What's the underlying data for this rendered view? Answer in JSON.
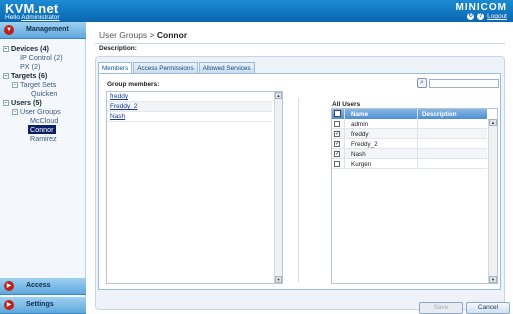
{
  "app": {
    "title": "KVM.net",
    "greeting": "Hello",
    "user": "Administrator",
    "brand_logo": "MINICOM",
    "logout": "Logout"
  },
  "sidebar": {
    "sections": {
      "management": "Management",
      "access": "Access",
      "settings": "Settings"
    },
    "tree": {
      "devices": "Devices (4)",
      "ip_control": "IP Control (2)",
      "px": "PX (2)",
      "targets": "Targets (6)",
      "target_sets": "Target Sets",
      "quicken": "Quicken",
      "users": "Users (5)",
      "user_groups": "User Groups",
      "mccloud": "McCloud",
      "connor": "Connor",
      "ramirez": "Ramirez"
    }
  },
  "main": {
    "breadcrumb_root": "User Groups",
    "breadcrumb_sep": ">",
    "breadcrumb_current": "Connor",
    "description_label": "Description:",
    "tabs": [
      "Members",
      "Access Permissions",
      "Allowed Services"
    ],
    "group_members_label": "Group members:",
    "group_members": [
      "freddy",
      "Freddy_2",
      "Nash"
    ],
    "all_users_label": "All Users",
    "columns": {
      "name": "Name",
      "description": "Description"
    },
    "users": [
      {
        "name": "admin",
        "checked": false
      },
      {
        "name": "freddy",
        "checked": true
      },
      {
        "name": "Freddy_2",
        "checked": true
      },
      {
        "name": "Nash",
        "checked": true
      },
      {
        "name": "Kurgen",
        "checked": false
      }
    ],
    "save_label": "Save",
    "cancel_label": "Cancel"
  },
  "icons": {
    "refresh": "refresh-icon",
    "help": "help-icon",
    "search": "search-icon",
    "expand": "minus-icon"
  },
  "colors": {
    "header": "#0a67b0",
    "sidebar_section": "#5ea8dd",
    "selected": "#0a1f66",
    "section_icon": "#c0201b"
  }
}
